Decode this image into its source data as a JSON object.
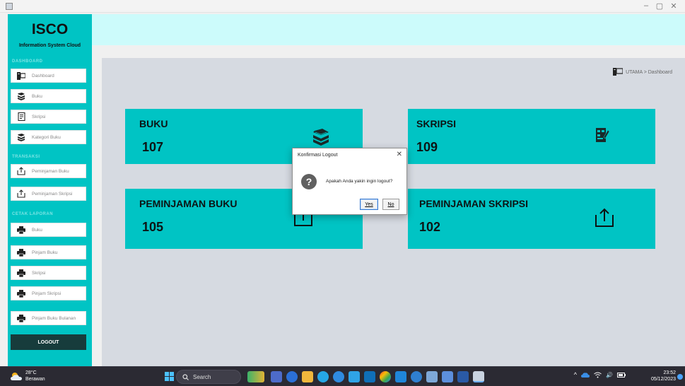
{
  "window": {
    "minimize": "–",
    "maximize": "▢",
    "close": "✕"
  },
  "sidebar": {
    "brand": "ISCO",
    "subtitle": "Information System Cloud",
    "sections": [
      {
        "label": "DASHBOARD",
        "items": [
          {
            "label": "Dashboard",
            "icon": "monitor-icon"
          },
          {
            "label": "Buku",
            "icon": "books-icon"
          },
          {
            "label": "Skripsi",
            "icon": "document-icon"
          },
          {
            "label": "Kategori Buku",
            "icon": "books-icon"
          }
        ]
      },
      {
        "label": "TRANSAKSI",
        "items": [
          {
            "label": "Peminjaman Buku",
            "icon": "upload-icon"
          },
          {
            "label": "Peminjaman Skripsi",
            "icon": "upload-icon"
          }
        ]
      },
      {
        "label": "CETAK LAPORAN",
        "items": [
          {
            "label": "Buku",
            "icon": "printer-icon"
          },
          {
            "label": "Pinjam Buku",
            "icon": "printer-icon"
          },
          {
            "label": "Skripsi",
            "icon": "printer-icon"
          },
          {
            "label": "Pinjam Skripsi",
            "icon": "printer-icon"
          },
          {
            "label": "Pinjam Buku Bulanan",
            "icon": "printer-icon"
          }
        ]
      }
    ],
    "logout": "LOGOUT"
  },
  "breadcrumb": "UTAMA > Dashboard",
  "cards": [
    {
      "title": "BUKU",
      "value": "107",
      "icon": "books-icon"
    },
    {
      "title": "SKRIPSI",
      "value": "109",
      "icon": "document-edit-icon"
    },
    {
      "title": "PEMINJAMAN BUKU",
      "value": "105",
      "icon": "upload-icon"
    },
    {
      "title": "PEMINJAMAN SKRIPSI",
      "value": "102",
      "icon": "upload-icon"
    }
  ],
  "dialog": {
    "title": "Konfirmasi Logout",
    "message": "Apakah Anda yakin ingin logout?",
    "yes": "Yes",
    "no": "No",
    "close": "✕",
    "question_mark": "?"
  },
  "taskbar": {
    "weather_temp": "28°C",
    "weather_desc": "Berawan",
    "search_label": "Search",
    "tray_chevron": "^",
    "tray_volume": "🔊",
    "time": "23:52",
    "date": "05/12/2023"
  },
  "colors": {
    "accent": "#00c4c4",
    "header": "#ccfbfb",
    "main_bg": "#d6dae1",
    "logout_bg": "#173c3c"
  }
}
